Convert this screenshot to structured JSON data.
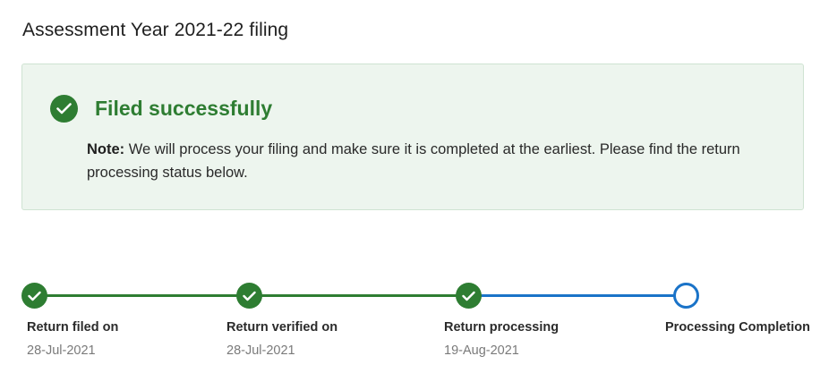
{
  "page": {
    "title": "Assessment Year 2021-22 filing"
  },
  "status": {
    "title": "Filed successfully",
    "note_label": "Note:",
    "note_text": " We will process your filing and make sure it is completed at the earliest. Please find the return processing status below.",
    "icon": "check-circle-icon"
  },
  "colors": {
    "success": "#2e7d32",
    "progress_blue": "#1a73c8",
    "panel_bg": "#edf5ee"
  },
  "timeline": {
    "steps": [
      {
        "label": "Return filed on",
        "date": "28-Jul-2021",
        "state": "done"
      },
      {
        "label": "Return verified on",
        "date": "28-Jul-2021",
        "state": "done"
      },
      {
        "label": "Return processing",
        "date": "19-Aug-2021",
        "state": "done"
      },
      {
        "label": "Processing Completion",
        "date": "",
        "state": "pending"
      }
    ]
  }
}
